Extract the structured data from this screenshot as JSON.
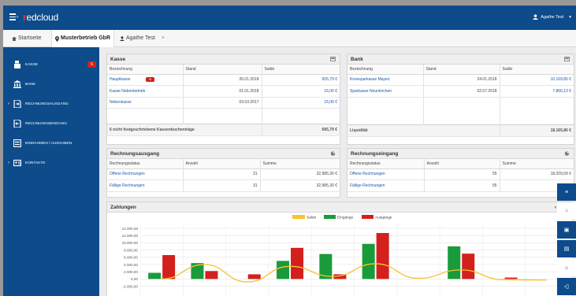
{
  "app": {
    "logo_accent": "r",
    "logo_text": "edcloud",
    "user_name": "Agathe Test",
    "user_caret": "▾"
  },
  "tabs": [
    {
      "label": "Startseite",
      "active": false
    },
    {
      "label": "Musterbetrieb GbR",
      "active": true
    },
    {
      "label": "Agathe Test",
      "active": false,
      "close": "×"
    }
  ],
  "sidebar": {
    "items": [
      {
        "label": "KASSE",
        "badge": "6",
        "icon": "cash-register-icon"
      },
      {
        "label": "BANK",
        "icon": "bank-icon"
      },
      {
        "label": "RECHNUNGSAUSGANG",
        "icon": "outgoing-invoice-icon",
        "arrow": "›"
      },
      {
        "label": "RECHNUNGSEINGANG",
        "icon": "incoming-invoice-icon"
      },
      {
        "label": "EINNAHMEN / AUSGABEN",
        "icon": "income-expense-icon"
      },
      {
        "label": "KONTAKTE",
        "icon": "contacts-icon",
        "arrow": "›"
      }
    ]
  },
  "kasse": {
    "title": "Kasse",
    "headers": [
      "Bezeichnung",
      "Stand",
      "Saldo"
    ],
    "rows": [
      {
        "name": "Hauptkasse",
        "badge": "6",
        "date": "26.01.2018",
        "saldo": "655,79 €"
      },
      {
        "name": "Kasse Nebenbetrieb",
        "date": "01.01.2018",
        "saldo": "15,00 €"
      },
      {
        "name": "Nebenkasse",
        "date": "03.03.2017",
        "saldo": "15,00 €"
      }
    ],
    "footer_label": "6 nicht festgeschriebene Kassenbuchenträge",
    "footer_value": "685,79 €"
  },
  "bank": {
    "title": "Bank",
    "headers": [
      "Bezeichnung",
      "Stand",
      "Saldo"
    ],
    "rows": [
      {
        "name": "Kreissparkasse Mayen",
        "date": "24.01.2018",
        "saldo": "10.169,80 €"
      },
      {
        "name": "Sparkasse Neunkirchen",
        "date": "02.07.2018",
        "saldo": "7.866,13 €"
      }
    ],
    "footer_label": "Liquidität",
    "footer_value": "18.165,86 €"
  },
  "ausgang": {
    "title": "Rechnungsausgang",
    "headers": [
      "Rechnungsstatus",
      "Anzahl",
      "Summe"
    ],
    "rows": [
      {
        "status": "Offene Rechnungen",
        "count": "31",
        "sum": "32.985,30 €"
      },
      {
        "status": "Fällige Rechnungen",
        "count": "31",
        "sum": "32.985,30 €"
      }
    ]
  },
  "eingang": {
    "title": "Rechnungseingang",
    "headers": [
      "Rechnungsstatus",
      "Anzahl",
      "Summe"
    ],
    "rows": [
      {
        "status": "Offene Rechnungen",
        "count": "55",
        "sum": "18.209,59 €"
      },
      {
        "status": "Fällige Rechnungen",
        "count": "55",
        "sum": "18.2"
      }
    ]
  },
  "zahlungen": {
    "title": "Zahlungen",
    "nav": "‹"
  },
  "chart_data": {
    "type": "bar",
    "title": "",
    "ylabel": "",
    "ylim": [
      -2000,
      14000
    ],
    "yticks": [
      "14.000,00",
      "12.000,00",
      "10.000,00",
      "8.000,00",
      "6.000,00",
      "4.000,00",
      "2.000,00",
      "0,00",
      "-2.000,00"
    ],
    "legend_position": "top-center",
    "series": [
      {
        "name": "Saldo",
        "color": "#f5c430",
        "values": [
          0,
          4000,
          -800,
          3500,
          700,
          4200,
          200,
          2500,
          -200,
          -300
        ]
      },
      {
        "name": "Eingänge",
        "color": "#199b3a",
        "values": [
          1700,
          4400,
          0,
          5000,
          6900,
          9700,
          0,
          9000,
          0,
          0
        ]
      },
      {
        "name": "Ausgänge",
        "color": "#d3201d",
        "values": [
          6600,
          2200,
          1300,
          8600,
          1300,
          12700,
          0,
          7000,
          400,
          0
        ]
      }
    ],
    "grid": true
  },
  "colors": {
    "nav": "#0d4b8a",
    "link": "#1a56a8",
    "badge": "#d0211c"
  }
}
